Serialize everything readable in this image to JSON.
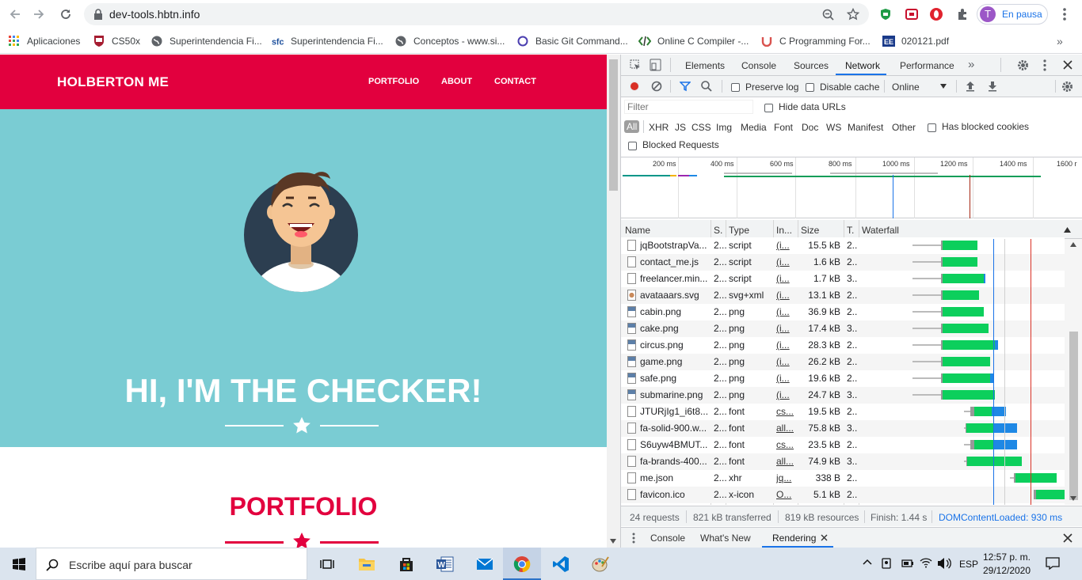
{
  "browser": {
    "url": "dev-tools.hbtn.info",
    "profile_initial": "T",
    "profile_label": "En pausa",
    "bookmarks": [
      {
        "label": "Aplicaciones",
        "icon": "apps-grid-icon"
      },
      {
        "label": "CS50x",
        "icon": "harvard-shield-icon"
      },
      {
        "label": "Superintendencia Fi...",
        "icon": "globe-icon"
      },
      {
        "label": "Superintendencia Fi...",
        "icon": "sfc-logo-icon"
      },
      {
        "label": "Conceptos - www.si...",
        "icon": "globe-icon"
      },
      {
        "label": "Basic Git Command...",
        "icon": "ring-icon"
      },
      {
        "label": "Online C Compiler -...",
        "icon": "code-brackets-icon"
      },
      {
        "label": "C Programming For...",
        "icon": "udemy-icon"
      },
      {
        "label": "020121.pdf",
        "icon": "pdf-icon"
      }
    ]
  },
  "site": {
    "brand": "HOLBERTON ME",
    "nav": [
      "PORTFOLIO",
      "ABOUT",
      "CONTACT"
    ],
    "hero_title": "HI, I'M THE CHECKER!",
    "section_title": "PORTFOLIO",
    "colors": {
      "primary": "#e2003e",
      "hero_bg": "#7accd3"
    }
  },
  "devtools": {
    "tabs": [
      "Elements",
      "Console",
      "Sources",
      "Network",
      "Performance"
    ],
    "active_tab": "Network",
    "toolbar": {
      "preserve_log": "Preserve log",
      "disable_cache": "Disable cache",
      "throttle": "Online"
    },
    "filter": {
      "placeholder": "Filter",
      "hide_data_urls": "Hide data URLs",
      "types": [
        "All",
        "XHR",
        "JS",
        "CSS",
        "Img",
        "Media",
        "Font",
        "Doc",
        "WS",
        "Manifest",
        "Other"
      ],
      "has_blocked_cookies": "Has blocked cookies",
      "blocked_requests": "Blocked Requests"
    },
    "overview_ticks": [
      "200 ms",
      "400 ms",
      "600 ms",
      "800 ms",
      "1000 ms",
      "1200 ms",
      "1400 ms",
      "1600 r"
    ],
    "columns": [
      "Name",
      "S.",
      "Type",
      "In...",
      "Size",
      "T.",
      "Waterfall"
    ],
    "rows": [
      {
        "name": "jqBootstrapVa...",
        "status": "2...",
        "type": "script",
        "initiator": "(i...",
        "size": "15.5 kB",
        "time": "2...",
        "icon": "file-icon"
      },
      {
        "name": "contact_me.js",
        "status": "2...",
        "type": "script",
        "initiator": "(i...",
        "size": "1.6 kB",
        "time": "2...",
        "icon": "file-icon"
      },
      {
        "name": "freelancer.min...",
        "status": "2...",
        "type": "script",
        "initiator": "(i...",
        "size": "1.7 kB",
        "time": "3...",
        "icon": "file-icon"
      },
      {
        "name": "avataaars.svg",
        "status": "2...",
        "type": "svg+xml",
        "initiator": "(i...",
        "size": "13.1 kB",
        "time": "2...",
        "icon": "svg-thumb-icon"
      },
      {
        "name": "cabin.png",
        "status": "2...",
        "type": "png",
        "initiator": "(i...",
        "size": "36.9 kB",
        "time": "2...",
        "icon": "png-thumb-icon"
      },
      {
        "name": "cake.png",
        "status": "2...",
        "type": "png",
        "initiator": "(i...",
        "size": "17.4 kB",
        "time": "3...",
        "icon": "png-thumb-icon"
      },
      {
        "name": "circus.png",
        "status": "2...",
        "type": "png",
        "initiator": "(i...",
        "size": "28.3 kB",
        "time": "2...",
        "icon": "png-thumb-icon"
      },
      {
        "name": "game.png",
        "status": "2...",
        "type": "png",
        "initiator": "(i...",
        "size": "26.2 kB",
        "time": "2...",
        "icon": "png-thumb-icon"
      },
      {
        "name": "safe.png",
        "status": "2...",
        "type": "png",
        "initiator": "(i...",
        "size": "19.6 kB",
        "time": "2...",
        "icon": "png-thumb-icon"
      },
      {
        "name": "submarine.png",
        "status": "2...",
        "type": "png",
        "initiator": "(i...",
        "size": "24.7 kB",
        "time": "3...",
        "icon": "png-thumb-icon"
      },
      {
        "name": "JTURjIg1_i6t8...",
        "status": "2...",
        "type": "font",
        "initiator": "cs...",
        "size": "19.5 kB",
        "time": "2...",
        "icon": "file-icon"
      },
      {
        "name": "fa-solid-900.w...",
        "status": "2...",
        "type": "font",
        "initiator": "all...",
        "size": "75.8 kB",
        "time": "3...",
        "icon": "file-icon"
      },
      {
        "name": "S6uyw4BMUT...",
        "status": "2...",
        "type": "font",
        "initiator": "cs...",
        "size": "23.5 kB",
        "time": "2...",
        "icon": "file-icon"
      },
      {
        "name": "fa-brands-400...",
        "status": "2...",
        "type": "font",
        "initiator": "all...",
        "size": "74.9 kB",
        "time": "3...",
        "icon": "file-icon"
      },
      {
        "name": "me.json",
        "status": "2...",
        "type": "xhr",
        "initiator": "jq...",
        "size": "338 B",
        "time": "2...",
        "icon": "file-icon"
      },
      {
        "name": "favicon.ico",
        "status": "2...",
        "type": "x-icon",
        "initiator": "O...",
        "size": "5.1 kB",
        "time": "2...",
        "icon": "file-icon"
      }
    ],
    "status": {
      "requests": "24 requests",
      "transferred": "821 kB transferred",
      "resources": "819 kB resources",
      "finish": "Finish: 1.44 s",
      "dcl": "DOMContentLoaded: 930 ms"
    },
    "drawer_tabs": [
      "Console",
      "What's New",
      "Rendering"
    ]
  },
  "taskbar": {
    "search_placeholder": "Escribe aquí para buscar",
    "lang": "ESP",
    "time": "12:57 p. m.",
    "date": "29/12/2020"
  }
}
